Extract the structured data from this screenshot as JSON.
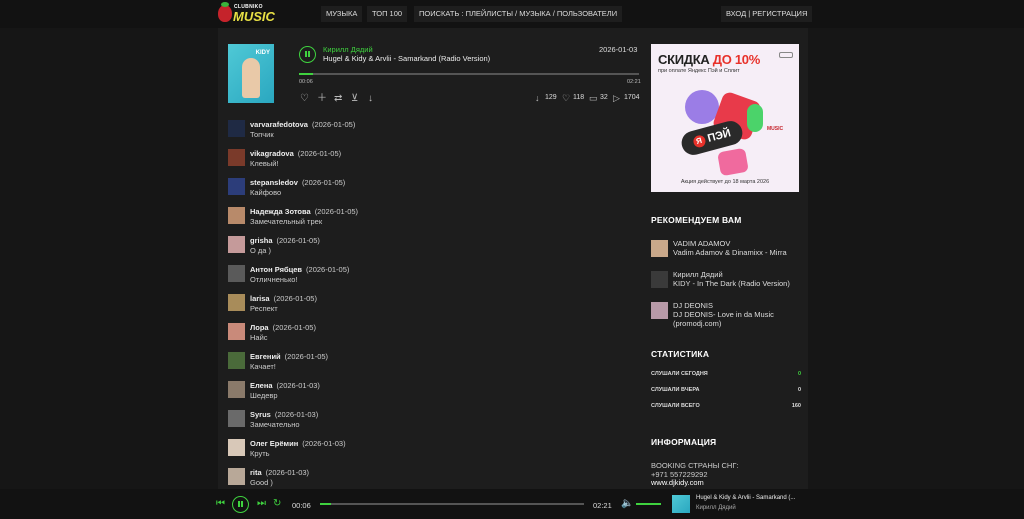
{
  "logo": {
    "line1": "CLUBNIKO",
    "line2": "MUSIC"
  },
  "nav": {
    "music": "МУЗЫКА",
    "top100": "ТОП 100",
    "search": "ПОИСКАТЬ : ПЛЕЙЛИСТЫ / МУЗЫКА / ПОЛЬЗОВАТЕЛИ",
    "auth": "ВХОД | РЕГИСТРАЦИЯ"
  },
  "track": {
    "cover_text": "KIDY",
    "artist": "Кирилл Дядий",
    "title": "Hugel & Kidy & Arvlii - Samarkand (Radio Version)",
    "date": "2026-01-03",
    "time_current": "00:06",
    "time_total": "02:21",
    "progress": 0.04,
    "stats": {
      "downloads": "129",
      "likes": "118",
      "comments": "32",
      "plays": "1704"
    }
  },
  "comments": [
    {
      "user": "varvarafedotova",
      "date": "(2026-01-05)",
      "text": "Топчик",
      "color": "#1f2a44"
    },
    {
      "user": "vikagradova",
      "date": "(2026-01-05)",
      "text": "Клевый!",
      "color": "#7a3a2a"
    },
    {
      "user": "stepansledov",
      "date": "(2026-01-05)",
      "text": "Кайфово",
      "color": "#2c3d7a"
    },
    {
      "user": "Надежда Зотова",
      "date": "(2026-01-05)",
      "text": "Замечательный трек",
      "color": "#b88a6a"
    },
    {
      "user": "grisha",
      "date": "(2026-01-05)",
      "text": "О да )",
      "color": "#c59a9a"
    },
    {
      "user": "Антон Рябцев",
      "date": "(2026-01-05)",
      "text": "Отличненько!",
      "color": "#5a5a5a"
    },
    {
      "user": "larisa",
      "date": "(2026-01-05)",
      "text": "Респект",
      "color": "#a88c5a"
    },
    {
      "user": "Лора",
      "date": "(2026-01-05)",
      "text": "Найс",
      "color": "#c98a7a"
    },
    {
      "user": "Евгений",
      "date": "(2026-01-05)",
      "text": "Качает!",
      "color": "#4a6a3a"
    },
    {
      "user": "Елена",
      "date": "(2026-01-03)",
      "text": "Шедевр",
      "color": "#8a7a6a"
    },
    {
      "user": "Syrus",
      "date": "(2026-01-03)",
      "text": "Замечательно",
      "color": "#6a6a6a"
    },
    {
      "user": "Олег Ерёмин",
      "date": "(2026-01-03)",
      "text": "Круть",
      "color": "#d8c8b8"
    },
    {
      "user": "rita",
      "date": "(2026-01-03)",
      "text": "Good )",
      "color": "#b8a898"
    }
  ],
  "ad": {
    "headline_a": "СКИДКА ",
    "headline_b": "ДО 10%",
    "sub": "при оплате Яндекс Пэй и Сплит",
    "pill": "ПЭЙ",
    "pill_letter": "Я",
    "mini_logo": "MUSIC",
    "footer": "Акция действует до 18 марта 2026"
  },
  "recommend": {
    "title": "РЕКОМЕНДУЕМ ВАМ",
    "items": [
      {
        "artist": "VADIM ADAMOV",
        "track": "Vadim Adamov & Dinamixx - Mirra",
        "color": "#c9a88a"
      },
      {
        "artist": "Кирилл Дядий",
        "track": "KIDY - In The Dark (Radio Version)",
        "color": "#3a3a3a"
      },
      {
        "artist": "DJ DEONIS",
        "track": "DJ DEONIS- Love in da Music (promodj.com)",
        "color": "#b89aa8"
      }
    ]
  },
  "statistics": {
    "title": "СТАТИСТИКА",
    "rows": [
      {
        "label": "СЛУШАЛИ СЕГОДНЯ",
        "value": "0",
        "color": "#3fd23f"
      },
      {
        "label": "СЛУШАЛИ ВЧЕРА",
        "value": "0",
        "color": "#dddddd"
      },
      {
        "label": "СЛУШАЛИ ВСЕГО",
        "value": "160",
        "color": "#dddddd"
      }
    ]
  },
  "info": {
    "title": "ИНФОРМАЦИЯ",
    "line1": "BOOKING СТРАНЫ СНГ:",
    "line2": "+971 557229292",
    "line3": "www.djkidy.com"
  },
  "player": {
    "time_current": "00:06",
    "time_total": "02:21",
    "progress": 0.04,
    "title": "Hugel & Kidy & Arvlii - Samarkand (...",
    "artist": "Кирилл Дядий"
  },
  "colors": {
    "accent": "#3fd23f",
    "background": "#161616",
    "panel": "#1d1d1d"
  }
}
